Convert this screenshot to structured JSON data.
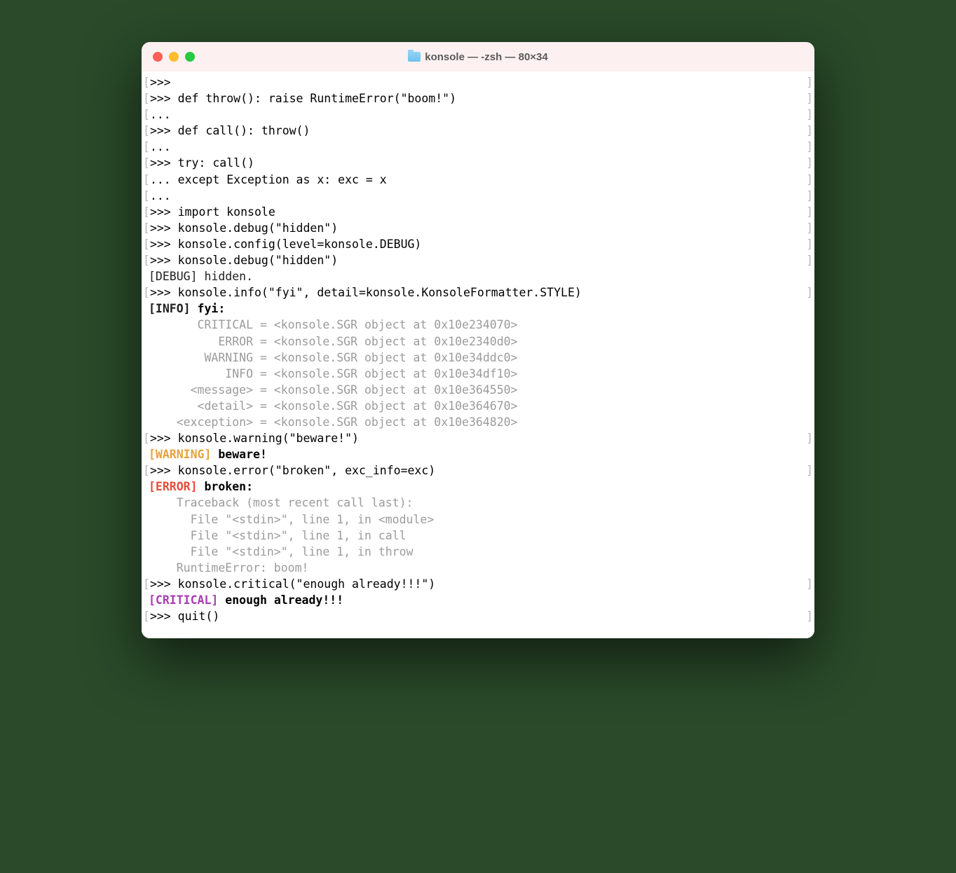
{
  "window": {
    "title": "konsole — -zsh — 80×34"
  },
  "prompts": {
    "primary": ">>>",
    "continuation": "..."
  },
  "brackets": {
    "l": "[",
    "r": "]"
  },
  "lines": {
    "l0": "",
    "l1": " def throw(): raise RuntimeError(\"boom!\")",
    "l2": "",
    "l3": " def call(): throw()",
    "l4": "",
    "l5": " try: call()",
    "l6": " except Exception as x: exc = x",
    "l7": "",
    "l8": " import konsole",
    "l9": " konsole.debug(\"hidden\")",
    "l10": " konsole.config(level=konsole.DEBUG)",
    "l11": " konsole.debug(\"hidden\")",
    "l12_debug": "[DEBUG] hidden.",
    "l13": " konsole.info(\"fyi\", detail=konsole.KonsoleFormatter.STYLE)",
    "l14_info_tag": "[INFO]",
    "l14_info_msg": " fyi:",
    "style_rows": [
      "       CRITICAL = <konsole.SGR object at 0x10e234070>",
      "          ERROR = <konsole.SGR object at 0x10e2340d0>",
      "        WARNING = <konsole.SGR object at 0x10e34ddc0>",
      "           INFO = <konsole.SGR object at 0x10e34df10>",
      "      <message> = <konsole.SGR object at 0x10e364550>",
      "       <detail> = <konsole.SGR object at 0x10e364670>",
      "    <exception> = <konsole.SGR object at 0x10e364820>"
    ],
    "l22": " konsole.warning(\"beware!\")",
    "l23_warn_tag": "[WARNING]",
    "l23_warn_msg": " beware!",
    "l24": " konsole.error(\"broken\", exc_info=exc)",
    "l25_err_tag": "[ERROR]",
    "l25_err_msg": " broken:",
    "traceback": [
      "    Traceback (most recent call last):",
      "      File \"<stdin>\", line 1, in <module>",
      "      File \"<stdin>\", line 1, in call",
      "      File \"<stdin>\", line 1, in throw",
      "    RuntimeError: boom!"
    ],
    "l31": " konsole.critical(\"enough already!!!\")",
    "l32_crit_tag": "[CRITICAL]",
    "l32_crit_msg": " enough already!!!",
    "l33": " quit()"
  }
}
